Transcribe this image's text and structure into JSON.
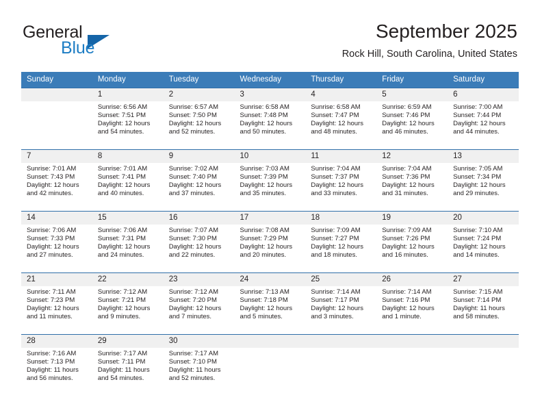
{
  "brand": {
    "name_part1": "General",
    "name_part2": "Blue",
    "logo_icon": "triangle-logo-icon"
  },
  "header": {
    "title": "September 2025",
    "location": "Rock Hill, South Carolina, United States"
  },
  "calendar": {
    "weekday_headers": [
      "Sunday",
      "Monday",
      "Tuesday",
      "Wednesday",
      "Thursday",
      "Friday",
      "Saturday"
    ],
    "accent_color": "#3b7cb8",
    "daynum_band_color": "#f0f0f0",
    "weeks": [
      [
        {
          "day": "",
          "sunrise": "",
          "sunset": "",
          "daylight_line1": "",
          "daylight_line2": ""
        },
        {
          "day": "1",
          "sunrise": "Sunrise: 6:56 AM",
          "sunset": "Sunset: 7:51 PM",
          "daylight_line1": "Daylight: 12 hours",
          "daylight_line2": "and 54 minutes."
        },
        {
          "day": "2",
          "sunrise": "Sunrise: 6:57 AM",
          "sunset": "Sunset: 7:50 PM",
          "daylight_line1": "Daylight: 12 hours",
          "daylight_line2": "and 52 minutes."
        },
        {
          "day": "3",
          "sunrise": "Sunrise: 6:58 AM",
          "sunset": "Sunset: 7:48 PM",
          "daylight_line1": "Daylight: 12 hours",
          "daylight_line2": "and 50 minutes."
        },
        {
          "day": "4",
          "sunrise": "Sunrise: 6:58 AM",
          "sunset": "Sunset: 7:47 PM",
          "daylight_line1": "Daylight: 12 hours",
          "daylight_line2": "and 48 minutes."
        },
        {
          "day": "5",
          "sunrise": "Sunrise: 6:59 AM",
          "sunset": "Sunset: 7:46 PM",
          "daylight_line1": "Daylight: 12 hours",
          "daylight_line2": "and 46 minutes."
        },
        {
          "day": "6",
          "sunrise": "Sunrise: 7:00 AM",
          "sunset": "Sunset: 7:44 PM",
          "daylight_line1": "Daylight: 12 hours",
          "daylight_line2": "and 44 minutes."
        }
      ],
      [
        {
          "day": "7",
          "sunrise": "Sunrise: 7:01 AM",
          "sunset": "Sunset: 7:43 PM",
          "daylight_line1": "Daylight: 12 hours",
          "daylight_line2": "and 42 minutes."
        },
        {
          "day": "8",
          "sunrise": "Sunrise: 7:01 AM",
          "sunset": "Sunset: 7:41 PM",
          "daylight_line1": "Daylight: 12 hours",
          "daylight_line2": "and 40 minutes."
        },
        {
          "day": "9",
          "sunrise": "Sunrise: 7:02 AM",
          "sunset": "Sunset: 7:40 PM",
          "daylight_line1": "Daylight: 12 hours",
          "daylight_line2": "and 37 minutes."
        },
        {
          "day": "10",
          "sunrise": "Sunrise: 7:03 AM",
          "sunset": "Sunset: 7:39 PM",
          "daylight_line1": "Daylight: 12 hours",
          "daylight_line2": "and 35 minutes."
        },
        {
          "day": "11",
          "sunrise": "Sunrise: 7:04 AM",
          "sunset": "Sunset: 7:37 PM",
          "daylight_line1": "Daylight: 12 hours",
          "daylight_line2": "and 33 minutes."
        },
        {
          "day": "12",
          "sunrise": "Sunrise: 7:04 AM",
          "sunset": "Sunset: 7:36 PM",
          "daylight_line1": "Daylight: 12 hours",
          "daylight_line2": "and 31 minutes."
        },
        {
          "day": "13",
          "sunrise": "Sunrise: 7:05 AM",
          "sunset": "Sunset: 7:34 PM",
          "daylight_line1": "Daylight: 12 hours",
          "daylight_line2": "and 29 minutes."
        }
      ],
      [
        {
          "day": "14",
          "sunrise": "Sunrise: 7:06 AM",
          "sunset": "Sunset: 7:33 PM",
          "daylight_line1": "Daylight: 12 hours",
          "daylight_line2": "and 27 minutes."
        },
        {
          "day": "15",
          "sunrise": "Sunrise: 7:06 AM",
          "sunset": "Sunset: 7:31 PM",
          "daylight_line1": "Daylight: 12 hours",
          "daylight_line2": "and 24 minutes."
        },
        {
          "day": "16",
          "sunrise": "Sunrise: 7:07 AM",
          "sunset": "Sunset: 7:30 PM",
          "daylight_line1": "Daylight: 12 hours",
          "daylight_line2": "and 22 minutes."
        },
        {
          "day": "17",
          "sunrise": "Sunrise: 7:08 AM",
          "sunset": "Sunset: 7:29 PM",
          "daylight_line1": "Daylight: 12 hours",
          "daylight_line2": "and 20 minutes."
        },
        {
          "day": "18",
          "sunrise": "Sunrise: 7:09 AM",
          "sunset": "Sunset: 7:27 PM",
          "daylight_line1": "Daylight: 12 hours",
          "daylight_line2": "and 18 minutes."
        },
        {
          "day": "19",
          "sunrise": "Sunrise: 7:09 AM",
          "sunset": "Sunset: 7:26 PM",
          "daylight_line1": "Daylight: 12 hours",
          "daylight_line2": "and 16 minutes."
        },
        {
          "day": "20",
          "sunrise": "Sunrise: 7:10 AM",
          "sunset": "Sunset: 7:24 PM",
          "daylight_line1": "Daylight: 12 hours",
          "daylight_line2": "and 14 minutes."
        }
      ],
      [
        {
          "day": "21",
          "sunrise": "Sunrise: 7:11 AM",
          "sunset": "Sunset: 7:23 PM",
          "daylight_line1": "Daylight: 12 hours",
          "daylight_line2": "and 11 minutes."
        },
        {
          "day": "22",
          "sunrise": "Sunrise: 7:12 AM",
          "sunset": "Sunset: 7:21 PM",
          "daylight_line1": "Daylight: 12 hours",
          "daylight_line2": "and 9 minutes."
        },
        {
          "day": "23",
          "sunrise": "Sunrise: 7:12 AM",
          "sunset": "Sunset: 7:20 PM",
          "daylight_line1": "Daylight: 12 hours",
          "daylight_line2": "and 7 minutes."
        },
        {
          "day": "24",
          "sunrise": "Sunrise: 7:13 AM",
          "sunset": "Sunset: 7:18 PM",
          "daylight_line1": "Daylight: 12 hours",
          "daylight_line2": "and 5 minutes."
        },
        {
          "day": "25",
          "sunrise": "Sunrise: 7:14 AM",
          "sunset": "Sunset: 7:17 PM",
          "daylight_line1": "Daylight: 12 hours",
          "daylight_line2": "and 3 minutes."
        },
        {
          "day": "26",
          "sunrise": "Sunrise: 7:14 AM",
          "sunset": "Sunset: 7:16 PM",
          "daylight_line1": "Daylight: 12 hours",
          "daylight_line2": "and 1 minute."
        },
        {
          "day": "27",
          "sunrise": "Sunrise: 7:15 AM",
          "sunset": "Sunset: 7:14 PM",
          "daylight_line1": "Daylight: 11 hours",
          "daylight_line2": "and 58 minutes."
        }
      ],
      [
        {
          "day": "28",
          "sunrise": "Sunrise: 7:16 AM",
          "sunset": "Sunset: 7:13 PM",
          "daylight_line1": "Daylight: 11 hours",
          "daylight_line2": "and 56 minutes."
        },
        {
          "day": "29",
          "sunrise": "Sunrise: 7:17 AM",
          "sunset": "Sunset: 7:11 PM",
          "daylight_line1": "Daylight: 11 hours",
          "daylight_line2": "and 54 minutes."
        },
        {
          "day": "30",
          "sunrise": "Sunrise: 7:17 AM",
          "sunset": "Sunset: 7:10 PM",
          "daylight_line1": "Daylight: 11 hours",
          "daylight_line2": "and 52 minutes."
        },
        {
          "day": "",
          "sunrise": "",
          "sunset": "",
          "daylight_line1": "",
          "daylight_line2": ""
        },
        {
          "day": "",
          "sunrise": "",
          "sunset": "",
          "daylight_line1": "",
          "daylight_line2": ""
        },
        {
          "day": "",
          "sunrise": "",
          "sunset": "",
          "daylight_line1": "",
          "daylight_line2": ""
        },
        {
          "day": "",
          "sunrise": "",
          "sunset": "",
          "daylight_line1": "",
          "daylight_line2": ""
        }
      ]
    ]
  }
}
